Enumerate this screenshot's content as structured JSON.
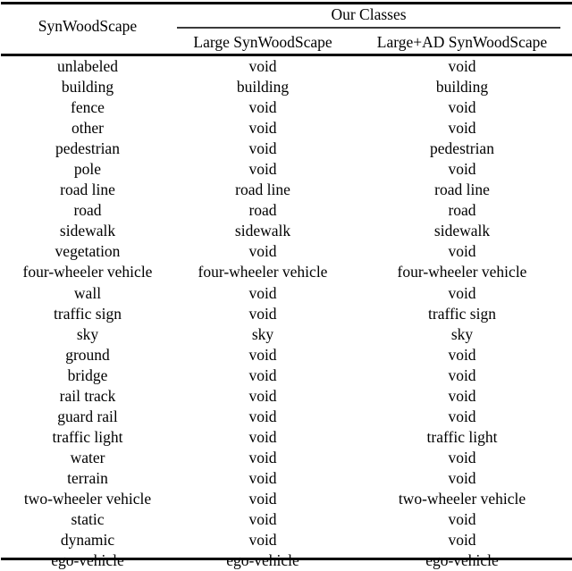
{
  "table": {
    "header": {
      "stub_label": "SynWoodScape",
      "group_label": "Our Classes",
      "sub_columns": [
        "Large SynWoodScape",
        "Large+AD SynWoodScape"
      ]
    },
    "columns": [
      "SynWoodScape",
      "Large SynWoodScape",
      "Large+AD SynWoodScape"
    ],
    "rows": [
      [
        "unlabeled",
        "void",
        "void"
      ],
      [
        "building",
        "building",
        "building"
      ],
      [
        "fence",
        "void",
        "void"
      ],
      [
        "other",
        "void",
        "void"
      ],
      [
        "pedestrian",
        "void",
        "pedestrian"
      ],
      [
        "pole",
        "void",
        "void"
      ],
      [
        "road line",
        "road line",
        "road line"
      ],
      [
        "road",
        "road",
        "road"
      ],
      [
        "sidewalk",
        "sidewalk",
        "sidewalk"
      ],
      [
        "vegetation",
        "void",
        "void"
      ],
      [
        "four-wheeler vehicle",
        "four-wheeler vehicle",
        "four-wheeler vehicle"
      ],
      [
        "wall",
        "void",
        "void"
      ],
      [
        "traffic sign",
        "void",
        "traffic sign"
      ],
      [
        "sky",
        "sky",
        "sky"
      ],
      [
        "ground",
        "void",
        "void"
      ],
      [
        "bridge",
        "void",
        "void"
      ],
      [
        "rail track",
        "void",
        "void"
      ],
      [
        "guard rail",
        "void",
        "void"
      ],
      [
        "traffic light",
        "void",
        "traffic light"
      ],
      [
        "water",
        "void",
        "void"
      ],
      [
        "terrain",
        "void",
        "void"
      ],
      [
        "two-wheeler vehicle",
        "void",
        "two-wheeler vehicle"
      ],
      [
        "static",
        "void",
        "void"
      ],
      [
        "dynamic",
        "void",
        "void"
      ],
      [
        "ego-vehicle",
        "ego-vehicle",
        "ego-vehicle"
      ]
    ]
  },
  "style": {
    "rule_color": "#000000",
    "cmidrule_color": "#3a3a3a",
    "text_color": "#000000",
    "background": "#ffffff"
  }
}
